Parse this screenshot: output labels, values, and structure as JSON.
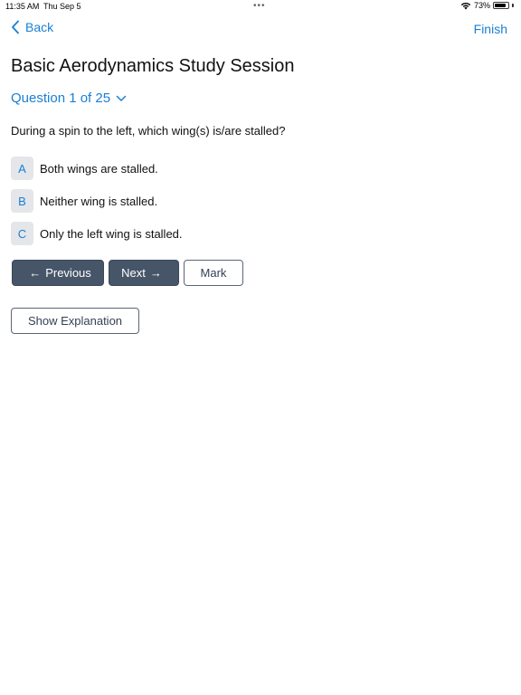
{
  "status_bar": {
    "time": "11:35 AM",
    "date": "Thu Sep 5",
    "dots": "•••",
    "battery": "73%"
  },
  "nav": {
    "back_label": "Back",
    "finish_label": "Finish"
  },
  "title": "Basic Aerodynamics Study Session",
  "question_selector": {
    "label": "Question 1 of 25"
  },
  "question": {
    "text": "During a spin to the left, which wing(s) is/are stalled?"
  },
  "answers": [
    {
      "letter": "A",
      "text": "Both wings are stalled."
    },
    {
      "letter": "B",
      "text": "Neither wing is stalled."
    },
    {
      "letter": "C",
      "text": "Only the left wing is stalled."
    }
  ],
  "buttons": {
    "previous": "Previous",
    "previous_arrow": "←",
    "next": "Next",
    "next_arrow": "→",
    "mark": "Mark",
    "show_explanation": "Show Explanation"
  },
  "colors": {
    "accent": "#1a7fd4",
    "button_dark": "#475569",
    "answer_bg": "#e4e6ea"
  },
  "icons": {
    "back": "chevron-left-icon",
    "question_dropdown": "chevron-down-icon",
    "wifi": "wifi-icon",
    "battery": "battery-icon"
  }
}
